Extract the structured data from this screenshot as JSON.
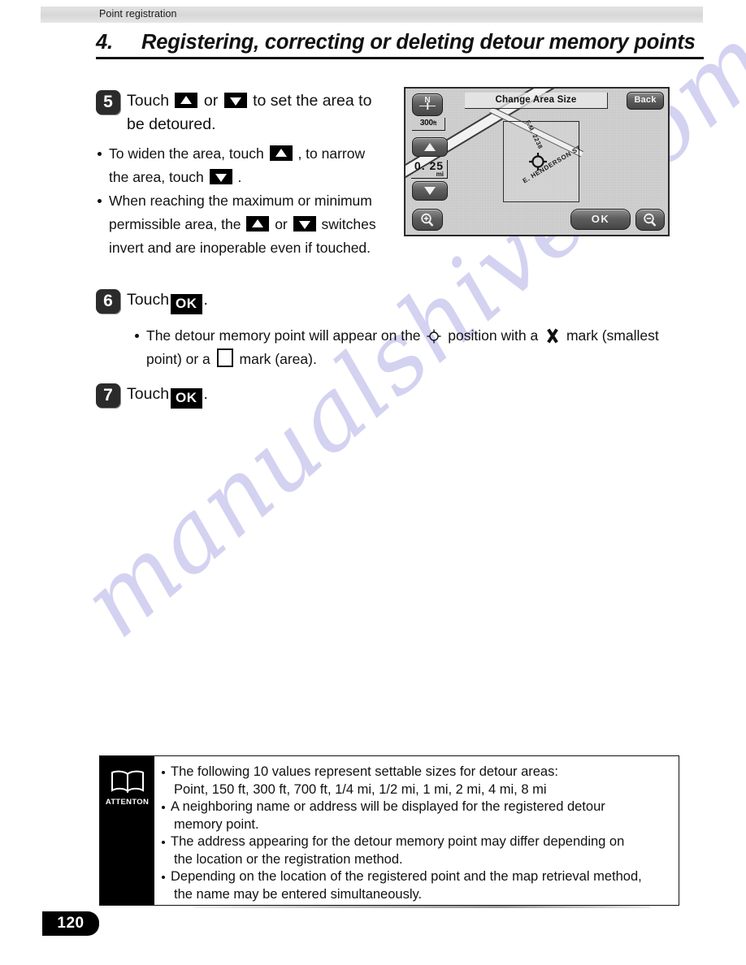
{
  "running_head": {
    "label": "Point registration"
  },
  "chapter": {
    "number": "4.",
    "title": "Registering, correcting or deleting detour memory points"
  },
  "watermark": {
    "text": "manualshive.com"
  },
  "steps": [
    {
      "number": "5",
      "lead_a": "Touch",
      "lead_b": "or",
      "lead_c": "to set the area to be detoured.",
      "bullets": [
        {
          "a": "To widen the area, touch",
          "b": ", to narrow the area, touch",
          "c": "."
        },
        {
          "a": "When reaching the maximum or minimum permissible area, the",
          "b": "or",
          "c": "switches invert and are inoperable even if touched."
        }
      ]
    },
    {
      "number": "6",
      "lead_a": "Touch",
      "ok_label": "OK",
      "lead_c": ".",
      "bullets": [
        {
          "a": "The detour memory point will appear on the",
          "b": "position with a",
          "c": "mark (smallest point) or a",
          "d": "mark (area)."
        }
      ]
    },
    {
      "number": "7",
      "lead_a": "Touch",
      "ok_label": "OK",
      "lead_c": "."
    }
  ],
  "nav_screen": {
    "title": "Change Area Size",
    "back_label": "Back",
    "ok_label": "OK",
    "compass_label": "N",
    "scale_value": "300",
    "scale_unit": "ft",
    "distance_value": "0. 25",
    "distance_unit": "mi",
    "up_icon": "triangle-up-icon",
    "down_icon": "triangle-down-icon",
    "zoom_in_icon": "magnifier-plus-icon",
    "zoom_out_icon": "magnifier-minus-icon",
    "map_labels": {
      "street_main": "E. HENDERSON ST",
      "street_secondary": "F.M. 2238"
    }
  },
  "attention": {
    "icon_label": "ATTENTON",
    "bullets": [
      {
        "line1": "The following 10 values represent settable sizes for detour areas:",
        "line2": "Point, 150 ft, 300 ft, 700 ft, 1/4 mi, 1/2 mi, 1 mi, 2 mi, 4 mi, 8 mi"
      },
      {
        "line1": "A neighboring name or address will be displayed for the registered detour",
        "line2": "memory point."
      },
      {
        "line1": "The address appearing for the detour memory point may differ depending on",
        "line2": "the location or the registration method."
      },
      {
        "line1": "Depending on the location of the registered point and the map retrieval method,",
        "line2": "the name may be entered simultaneously."
      }
    ]
  },
  "page_number": "120"
}
